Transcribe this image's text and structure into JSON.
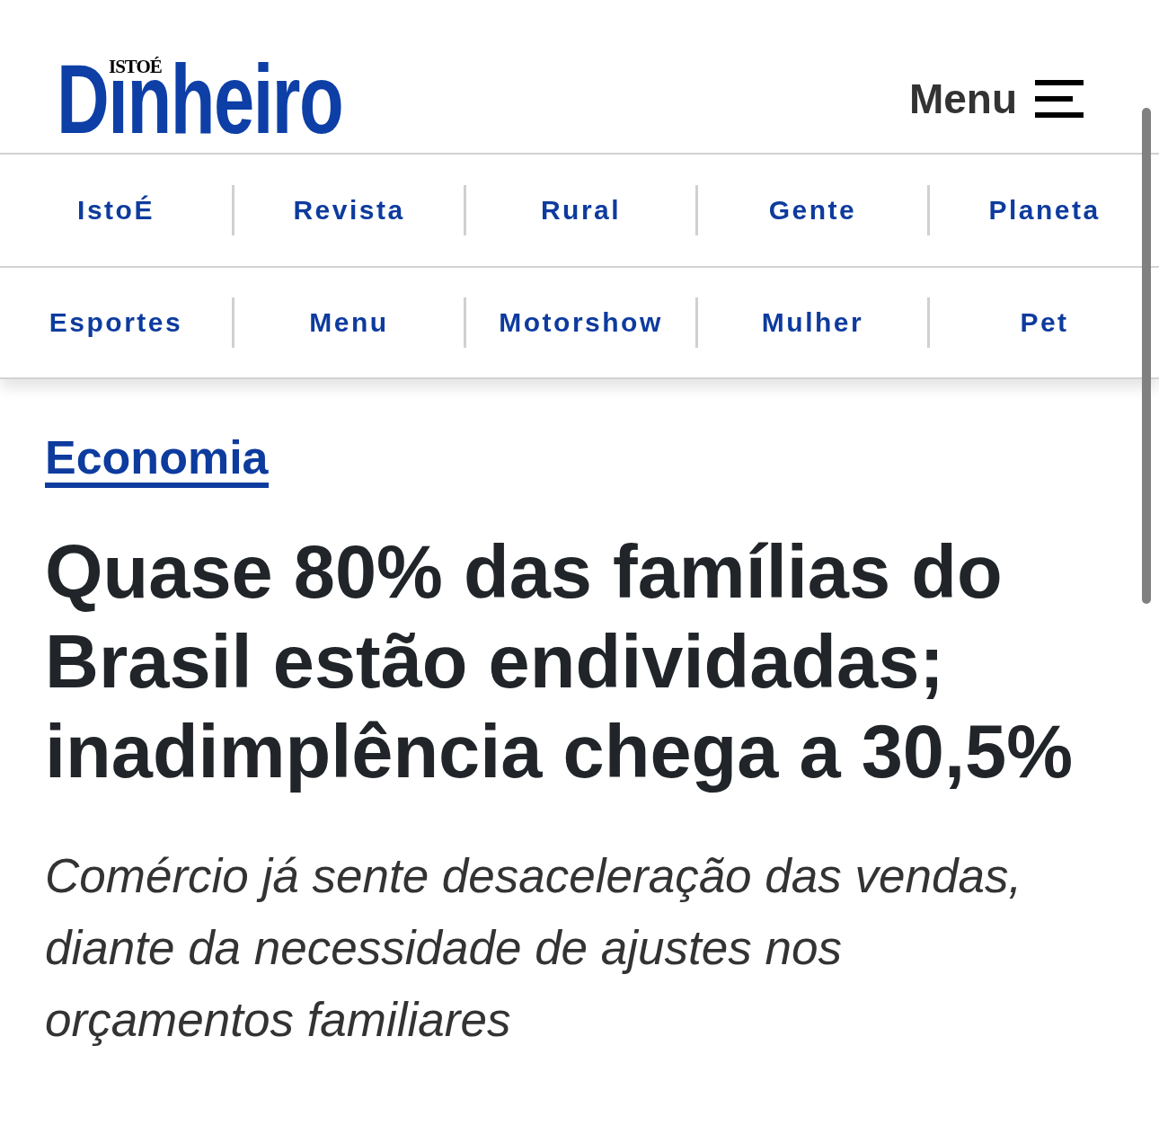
{
  "header": {
    "logo": {
      "kicker": "ISTOÉ",
      "wordmark": "Dinheiro"
    },
    "menu_label": "Menu"
  },
  "nav": {
    "rows": [
      {
        "links": [
          "IstoÉ",
          "Revista",
          "Rural",
          "Gente",
          "Planeta"
        ]
      },
      {
        "links": [
          "Esportes",
          "Menu",
          "Motorshow",
          "Mulher",
          "Pet"
        ]
      }
    ]
  },
  "article": {
    "category": "Economia",
    "headline": "Quase 80% das famílias do Brasil estão endividadas; inadimplência chega a 30,5%",
    "subtitle": "Comércio já sente desaceleração das vendas, diante da necessidade de ajustes nos orçamentos familiares"
  }
}
